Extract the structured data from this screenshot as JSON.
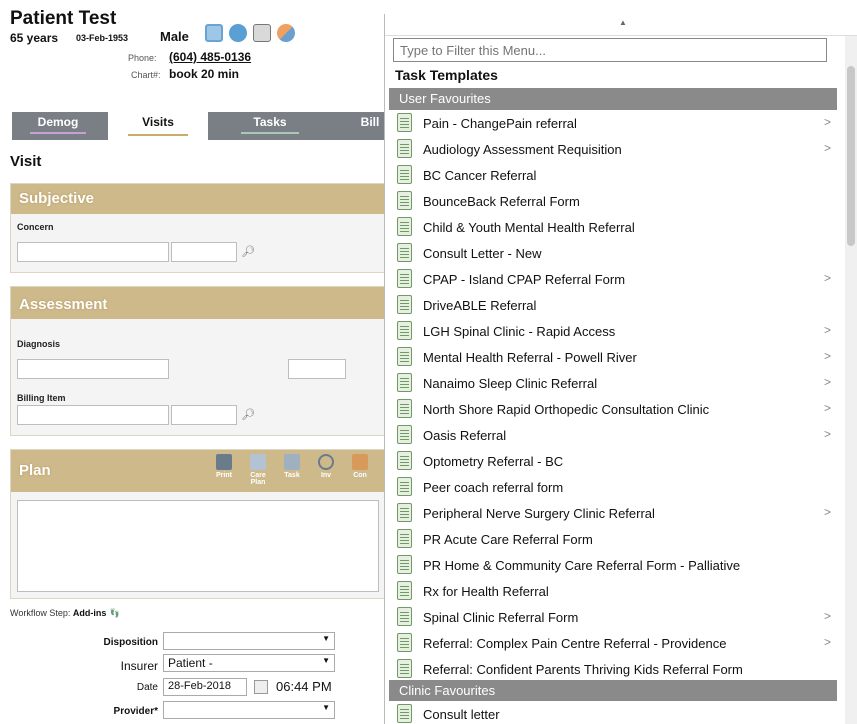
{
  "patient": {
    "name": "Patient Test",
    "age": "65 years",
    "dob": "03-Feb-1953",
    "sex": "Male",
    "phone_label": "Phone:",
    "phone": "(604) 485-0136",
    "chart_label": "Chart#:",
    "chart": "book 20 min"
  },
  "tabs": [
    {
      "label": "Demog",
      "underline": "#c8a0d8"
    },
    {
      "label": "Visits",
      "underline": "#c9ad6a"
    },
    {
      "label": "Tasks",
      "underline": "#a7c9b5"
    },
    {
      "label": "Bill",
      "underline": "#d0b080"
    }
  ],
  "visit": {
    "title": "Visit",
    "subjective": {
      "heading": "Subjective",
      "concern_label": "Concern"
    },
    "assessment": {
      "heading": "Assessment",
      "diagnosis_label": "Diagnosis",
      "billing_label": "Billing Item"
    },
    "plan": {
      "heading": "Plan",
      "tools": [
        {
          "label": "Print",
          "icon": "printer-icon"
        },
        {
          "label": "Care Plan",
          "icon": "care-plan-icon"
        },
        {
          "label": "Task",
          "icon": "task-icon"
        },
        {
          "label": "Inv",
          "icon": "investigation-icon"
        },
        {
          "label": "Con",
          "icon": "consult-icon"
        }
      ]
    },
    "workflow_label": "Workflow Step:",
    "workflow_value": "Add-ins",
    "form": {
      "disposition_label": "Disposition",
      "disposition_value": "",
      "insurer_label": "Insurer",
      "insurer_value": "Patient -",
      "date_label": "Date",
      "date_value": "28-Feb-2018",
      "time_value": "06:44 PM",
      "provider_label": "Provider*",
      "provider_value": ""
    }
  },
  "menu": {
    "filter_placeholder": "Type to Filter this Menu...",
    "title": "Task Templates",
    "groups": {
      "user": "User Favourites",
      "clinic": "Clinic Favourites"
    },
    "user_items": [
      {
        "label": "Pain - ChangePain referral",
        "submenu": ">"
      },
      {
        "label": "Audiology Assessment Requisition",
        "submenu": ">"
      },
      {
        "label": "BC Cancer Referral",
        "submenu": ""
      },
      {
        "label": "BounceBack Referral Form",
        "submenu": ""
      },
      {
        "label": "Child & Youth Mental Health Referral",
        "submenu": ""
      },
      {
        "label": "Consult Letter - New",
        "submenu": ""
      },
      {
        "label": "CPAP - Island CPAP Referral Form",
        "submenu": ">"
      },
      {
        "label": "DriveABLE Referral",
        "submenu": ""
      },
      {
        "label": "LGH Spinal Clinic - Rapid Access",
        "submenu": ">"
      },
      {
        "label": "Mental Health Referral - Powell River",
        "submenu": ">"
      },
      {
        "label": "Nanaimo Sleep Clinic Referral",
        "submenu": ">"
      },
      {
        "label": "North Shore Rapid Orthopedic Consultation Clinic",
        "submenu": ">"
      },
      {
        "label": "Oasis Referral",
        "submenu": ">"
      },
      {
        "label": "Optometry Referral - BC",
        "submenu": ""
      },
      {
        "label": "Peer coach referral form",
        "submenu": ""
      },
      {
        "label": "Peripheral Nerve Surgery Clinic Referral",
        "submenu": ">"
      },
      {
        "label": "PR Acute Care Referral Form",
        "submenu": ""
      },
      {
        "label": "PR Home & Community Care Referral Form - Palliative",
        "submenu": ""
      },
      {
        "label": "Rx for Health Referral",
        "submenu": ""
      },
      {
        "label": "Spinal Clinic Referral Form",
        "submenu": ">"
      },
      {
        "label": "Referral: Complex Pain Centre Referral - Providence",
        "submenu": ">"
      },
      {
        "label": "Referral: Confident Parents Thriving Kids Referral Form",
        "submenu": ""
      }
    ],
    "clinic_items": [
      {
        "label": "Consult letter",
        "submenu": ""
      }
    ]
  },
  "colors": {
    "section_header": "#cdb98a",
    "tab_bar": "#7a7f86",
    "menu_group": "#8a8a8a"
  }
}
